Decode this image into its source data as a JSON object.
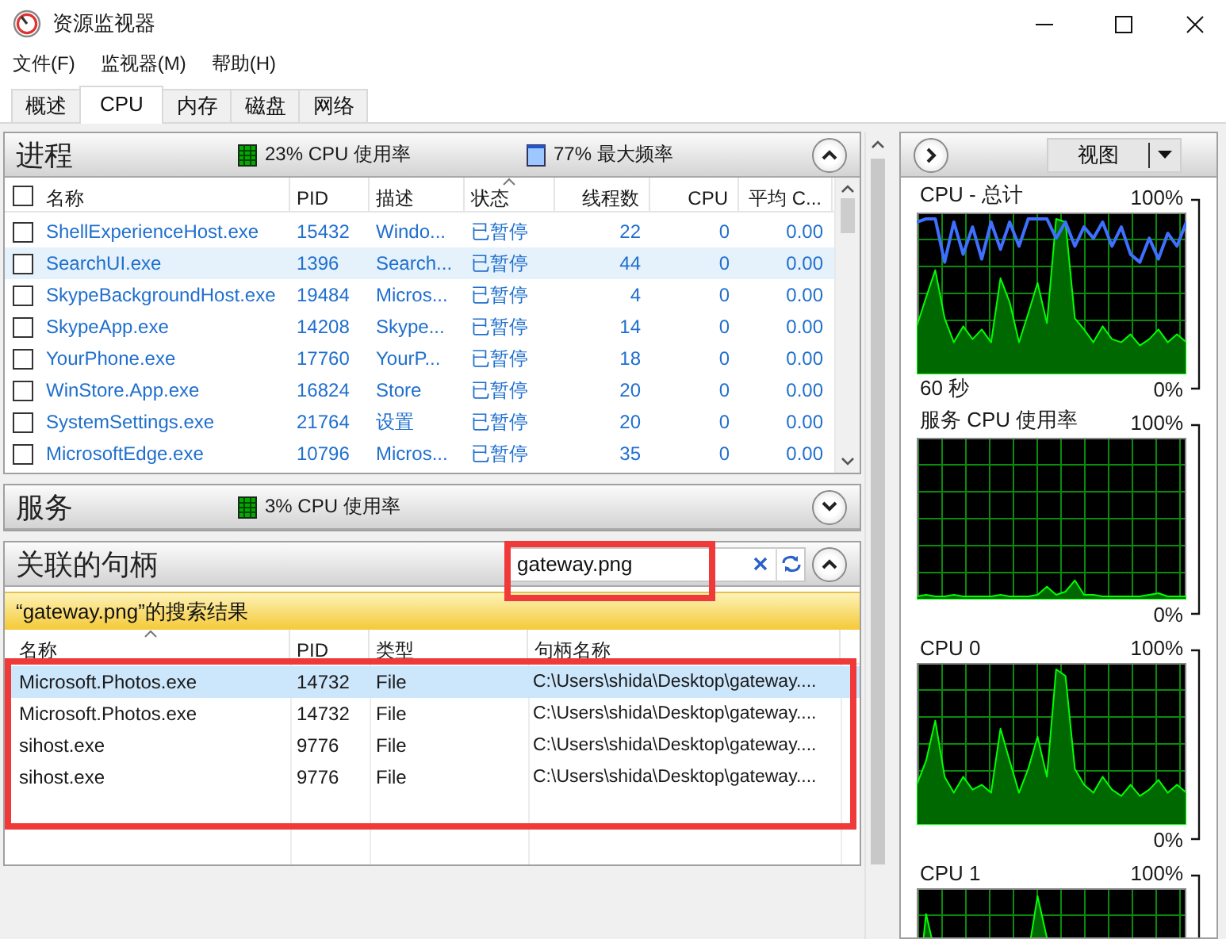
{
  "window": {
    "title": "资源监视器"
  },
  "menu": [
    {
      "label": "文件(F)"
    },
    {
      "label": "监视器(M)"
    },
    {
      "label": "帮助(H)"
    }
  ],
  "tabs": [
    {
      "label": "概述",
      "selected": false
    },
    {
      "label": "CPU",
      "selected": true
    },
    {
      "label": "内存",
      "selected": false
    },
    {
      "label": "磁盘",
      "selected": false
    },
    {
      "label": "网络",
      "selected": false
    }
  ],
  "processes": {
    "title": "进程",
    "cpu_usage": "23% CPU 使用率",
    "max_frequency": "77% 最大频率",
    "expanded": true,
    "select_all": {
      "checked": false
    },
    "columns": [
      {
        "label": "名称",
        "sorted": false
      },
      {
        "label": "PID",
        "sorted": false
      },
      {
        "label": "描述",
        "sorted": false
      },
      {
        "label": "状态",
        "sorted": true
      },
      {
        "label": "线程数",
        "sorted": false
      },
      {
        "label": "CPU",
        "sorted": false
      },
      {
        "label": "平均 C...",
        "sorted": false
      }
    ],
    "rows": [
      {
        "checked": false,
        "selected": false,
        "cells": [
          "ShellExperienceHost.exe",
          "15432",
          "Windo...",
          "已暂停",
          "22",
          "0",
          "0.00"
        ]
      },
      {
        "checked": false,
        "selected": true,
        "cells": [
          "SearchUI.exe",
          "1396",
          "Search...",
          "已暂停",
          "44",
          "0",
          "0.00"
        ]
      },
      {
        "checked": false,
        "selected": false,
        "cells": [
          "SkypeBackgroundHost.exe",
          "19484",
          "Micros...",
          "已暂停",
          "4",
          "0",
          "0.00"
        ]
      },
      {
        "checked": false,
        "selected": false,
        "cells": [
          "SkypeApp.exe",
          "14208",
          "Skype...",
          "已暂停",
          "14",
          "0",
          "0.00"
        ]
      },
      {
        "checked": false,
        "selected": false,
        "cells": [
          "YourPhone.exe",
          "17760",
          "YourP...",
          "已暂停",
          "18",
          "0",
          "0.00"
        ]
      },
      {
        "checked": false,
        "selected": false,
        "cells": [
          "WinStore.App.exe",
          "16824",
          "Store",
          "已暂停",
          "20",
          "0",
          "0.00"
        ]
      },
      {
        "checked": false,
        "selected": false,
        "cells": [
          "SystemSettings.exe",
          "21764",
          "设置",
          "已暂停",
          "20",
          "0",
          "0.00"
        ]
      },
      {
        "checked": false,
        "selected": false,
        "cells": [
          "MicrosoftEdge.exe",
          "10796",
          "Micros...",
          "已暂停",
          "35",
          "0",
          "0.00"
        ]
      }
    ]
  },
  "services": {
    "title": "服务",
    "cpu_usage": "3% CPU 使用率",
    "expanded": false
  },
  "handles": {
    "title": "关联的句柄",
    "expanded": true,
    "search": {
      "value": "gateway.png"
    },
    "banner": "“gateway.png”的搜索结果",
    "columns": [
      {
        "label": "名称",
        "sorted": true
      },
      {
        "label": "PID",
        "sorted": false
      },
      {
        "label": "类型",
        "sorted": false
      },
      {
        "label": "句柄名称",
        "sorted": false
      }
    ],
    "rows": [
      {
        "selected": true,
        "cells": [
          "Microsoft.Photos.exe",
          "14732",
          "File",
          "C:\\Users\\shida\\Desktop\\gateway...."
        ]
      },
      {
        "selected": false,
        "cells": [
          "Microsoft.Photos.exe",
          "14732",
          "File",
          "C:\\Users\\shida\\Desktop\\gateway...."
        ]
      },
      {
        "selected": false,
        "cells": [
          "sihost.exe",
          "9776",
          "File",
          "C:\\Users\\shida\\Desktop\\gateway...."
        ]
      },
      {
        "selected": false,
        "cells": [
          "sihost.exe",
          "9776",
          "File",
          "C:\\Users\\shida\\Desktop\\gateway...."
        ]
      }
    ]
  },
  "monitor": {
    "view_button": "视图",
    "graphs": [
      {
        "title": "CPU - 总计",
        "top_label": "100%",
        "bottom_label": "0%",
        "time_span": "60 秒",
        "max_frequency_line": true
      },
      {
        "title": "服务 CPU 使用率",
        "top_label": "100%",
        "bottom_label": "0%"
      },
      {
        "title": "CPU 0",
        "top_label": "100%",
        "bottom_label": "0%"
      },
      {
        "title": "CPU 1",
        "top_label": "100%"
      }
    ]
  }
}
